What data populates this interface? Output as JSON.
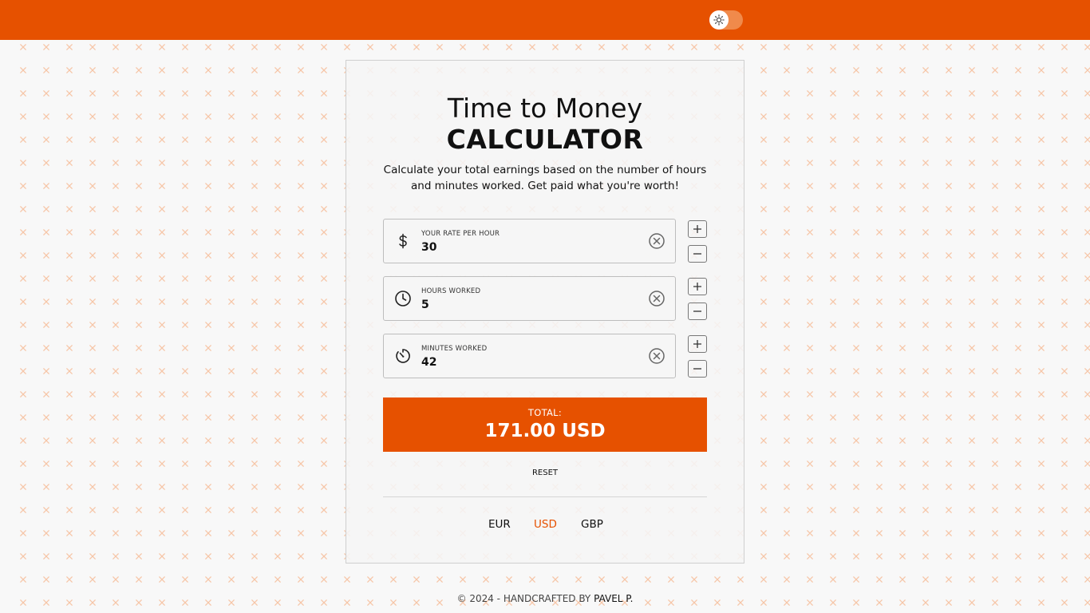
{
  "theme": {
    "accent": "#e65100",
    "background": "#f8f8f8",
    "pattern_color": "#f6c6a8"
  },
  "header": {
    "theme_toggle_icon": "sun-icon"
  },
  "calculator": {
    "title_line1": "Time to Money",
    "title_line2": "CALCULATOR",
    "subtitle": "Calculate your total earnings based on the number of hours and minutes worked. Get paid what you're worth!",
    "fields": [
      {
        "label": "YOUR RATE PER HOUR",
        "value": "30",
        "icon": "dollar-icon"
      },
      {
        "label": "HOURS WORKED",
        "value": "5",
        "icon": "clock-icon"
      },
      {
        "label": "MINUTES WORKED",
        "value": "42",
        "icon": "timer-icon"
      }
    ],
    "total_label": "TOTAL:",
    "total_value": "171.00 USD",
    "reset_label": "RESET",
    "currencies": [
      {
        "code": "EUR",
        "selected": false
      },
      {
        "code": "USD",
        "selected": true
      },
      {
        "code": "GBP",
        "selected": false
      }
    ]
  },
  "footer": {
    "text": "© 2024 - HANDCRAFTED BY ",
    "author": "PAVEL P."
  }
}
